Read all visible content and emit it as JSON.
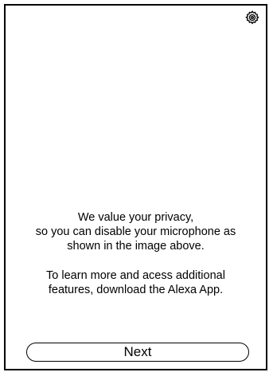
{
  "settings": {
    "icon": "gear-icon"
  },
  "message": {
    "privacy_lines": [
      "We value your privacy,",
      "so you can disable your microphone as",
      "shown in the image above."
    ],
    "app_lines": [
      "To learn more and acess additional",
      "features, download the Alexa App."
    ]
  },
  "footer": {
    "next_label": "Next"
  }
}
